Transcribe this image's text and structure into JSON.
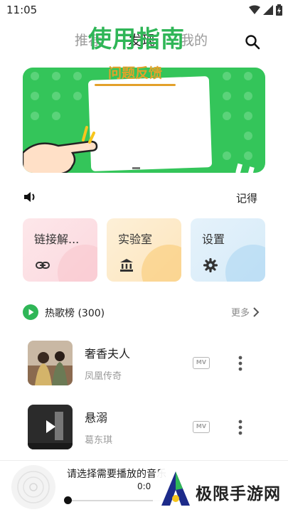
{
  "status": {
    "time": "11:05"
  },
  "nav": {
    "tabs": [
      "推荐",
      "发现",
      "我的"
    ],
    "active": 1
  },
  "banner": {
    "title": "使用指南",
    "subtitle": "问题反馈"
  },
  "info_row": {
    "record_label": "记得"
  },
  "shortcuts": [
    {
      "label": "链接解...",
      "icon": "link-icon",
      "color": "#f8c4cc"
    },
    {
      "label": "实验室",
      "icon": "bank-icon",
      "color": "#f9c970"
    },
    {
      "label": "设置",
      "icon": "gear-icon",
      "color": "#a9d6f2"
    }
  ],
  "hot": {
    "title": "热歌榜 (300)",
    "more_label": "更多"
  },
  "songs": [
    {
      "name": "奢香夫人",
      "artist": "凤凰传奇",
      "badge": "MV"
    },
    {
      "name": "悬溺",
      "artist": "葛东琪",
      "badge": "MV"
    }
  ],
  "player": {
    "prompt": "请选择需要播放的音乐",
    "time": "0:0",
    "progress": 0
  },
  "watermark": {
    "text": "极限手游网"
  },
  "colors": {
    "accent": "#2fb657",
    "banner_bg": "#34c55a",
    "subtitle": "#e3a12a"
  }
}
